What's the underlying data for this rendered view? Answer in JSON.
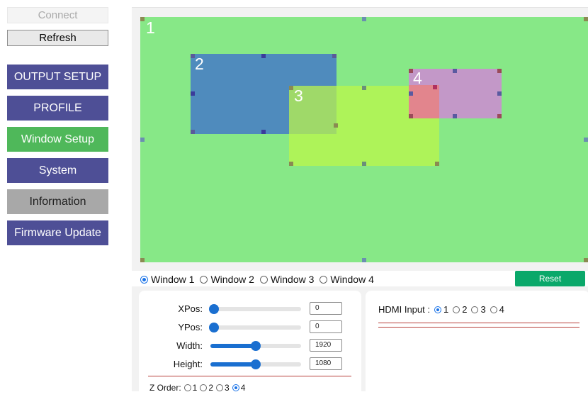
{
  "sidebar": {
    "connect_label": "Connect",
    "refresh_label": "Refresh",
    "items": [
      {
        "label": "OUTPUT SETUP"
      },
      {
        "label": "PROFILE"
      },
      {
        "label": "Window Setup"
      },
      {
        "label": "System"
      },
      {
        "label": "Information"
      },
      {
        "label": "Firmware Update"
      }
    ]
  },
  "canvas": {
    "windows": [
      {
        "label": "1",
        "color": "#87e887"
      },
      {
        "label": "2",
        "color": "#4f8bbd"
      },
      {
        "label": "3",
        "color": "#b6f450"
      },
      {
        "label": "4",
        "color": "#c69ad4"
      }
    ]
  },
  "window_select": {
    "options": [
      "Window 1",
      "Window 2",
      "Window 3",
      "Window 4"
    ],
    "selected": "Window 1",
    "reset_label": "Reset"
  },
  "position": {
    "xpos_label": "XPos:",
    "xpos_value": "0",
    "ypos_label": "YPos:",
    "ypos_value": "0",
    "width_label": "Width:",
    "width_value": "1920",
    "height_label": "Height:",
    "height_value": "1080",
    "zorder_label": "Z Order:",
    "zorder_options": [
      "1",
      "2",
      "3",
      "4"
    ],
    "zorder_selected": "4"
  },
  "hdmi": {
    "label": "HDMI Input :",
    "options": [
      "1",
      "2",
      "3",
      "4"
    ],
    "selected": "1"
  },
  "colors": {
    "nav_active": "#4fb85a",
    "nav_default": "#4e4f96",
    "nav_disabled": "#a8a8a8",
    "reset": "#0aa86a",
    "slider": "#1a6fd0"
  }
}
